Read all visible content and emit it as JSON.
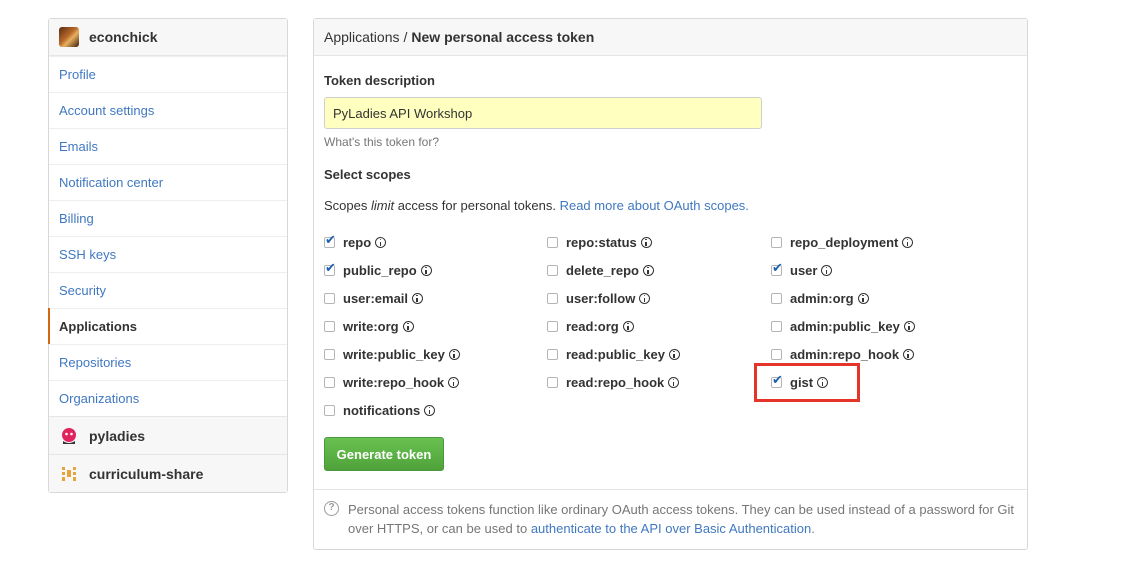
{
  "sidebar": {
    "user": "econchick",
    "items": [
      {
        "label": "Profile"
      },
      {
        "label": "Account settings"
      },
      {
        "label": "Emails"
      },
      {
        "label": "Notification center"
      },
      {
        "label": "Billing"
      },
      {
        "label": "SSH keys"
      },
      {
        "label": "Security"
      },
      {
        "label": "Applications",
        "selected": true
      },
      {
        "label": "Repositories"
      },
      {
        "label": "Organizations"
      }
    ],
    "orgs": [
      {
        "name": "pyladies",
        "icon": "pyladies-logo-icon",
        "color": "#e0245e"
      },
      {
        "name": "curriculum-share",
        "icon": "curriculum-share-logo-icon",
        "color": "#e8a33d"
      }
    ]
  },
  "header": {
    "breadcrumb_parent": "Applications",
    "breadcrumb_sep": "/",
    "breadcrumb_current": "New personal access token"
  },
  "form": {
    "description_label": "Token description",
    "description_value": "PyLadies API Workshop",
    "description_hint": "What's this token for?",
    "scopes_label": "Select scopes",
    "scopes_text_before": "Scopes ",
    "scopes_text_em": "limit",
    "scopes_text_after": " access for personal tokens. ",
    "scopes_link": "Read more about OAuth scopes."
  },
  "scopes": [
    {
      "name": "repo",
      "checked": true
    },
    {
      "name": "repo:status",
      "checked": false
    },
    {
      "name": "repo_deployment",
      "checked": false
    },
    {
      "name": "public_repo",
      "checked": true
    },
    {
      "name": "delete_repo",
      "checked": false
    },
    {
      "name": "user",
      "checked": true
    },
    {
      "name": "user:email",
      "checked": false
    },
    {
      "name": "user:follow",
      "checked": false
    },
    {
      "name": "admin:org",
      "checked": false
    },
    {
      "name": "write:org",
      "checked": false
    },
    {
      "name": "read:org",
      "checked": false
    },
    {
      "name": "admin:public_key",
      "checked": false
    },
    {
      "name": "write:public_key",
      "checked": false
    },
    {
      "name": "read:public_key",
      "checked": false
    },
    {
      "name": "admin:repo_hook",
      "checked": false
    },
    {
      "name": "write:repo_hook",
      "checked": false
    },
    {
      "name": "read:repo_hook",
      "checked": false
    },
    {
      "name": "gist",
      "checked": true
    },
    {
      "name": "notifications",
      "checked": false
    }
  ],
  "actions": {
    "generate_label": "Generate token",
    "generate_color": "#5cb246"
  },
  "footer": {
    "text": "Personal access tokens function like ordinary OAuth access tokens. They can be used instead of a password for Git over HTTPS, or can be used to ",
    "link": "authenticate to the API over Basic Authentication",
    "end": "."
  },
  "colors": {
    "link": "#4078c0",
    "selected_marker": "#d26911",
    "highlight": "#e5352b",
    "input_bg": "#ffffbf",
    "checkbox_check": "#1b5fb3"
  }
}
